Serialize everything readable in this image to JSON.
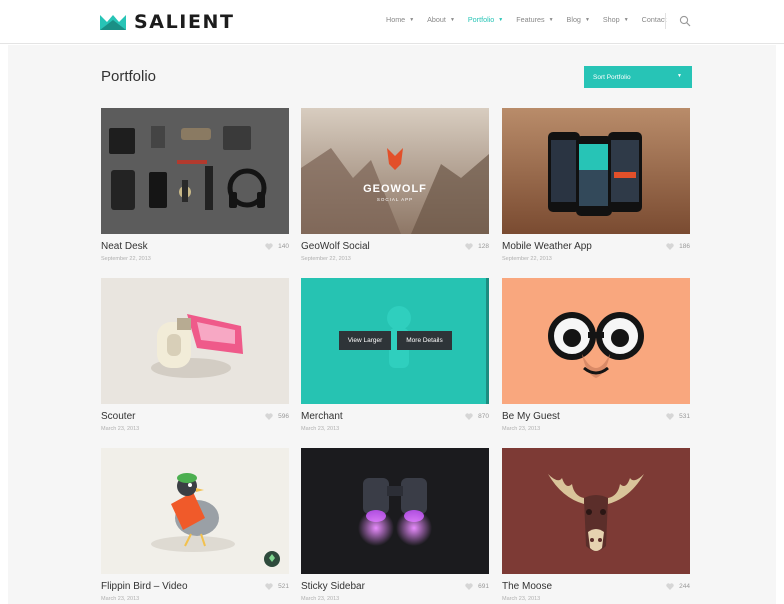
{
  "brand": {
    "name": "SALIENT",
    "accent": "#27c4b6"
  },
  "nav": {
    "items": [
      {
        "label": "Home",
        "has_dropdown": true,
        "active": false
      },
      {
        "label": "About",
        "has_dropdown": true,
        "active": false
      },
      {
        "label": "Portfolio",
        "has_dropdown": true,
        "active": true
      },
      {
        "label": "Features",
        "has_dropdown": true,
        "active": false
      },
      {
        "label": "Blog",
        "has_dropdown": true,
        "active": false
      },
      {
        "label": "Shop",
        "has_dropdown": true,
        "active": false
      },
      {
        "label": "Contact",
        "has_dropdown": false,
        "active": false
      }
    ],
    "search_icon": "search-icon"
  },
  "page": {
    "title": "Portfolio",
    "sort_label": "Sort Portfolio"
  },
  "items": [
    {
      "title": "Neat Desk",
      "date": "September 22, 2013",
      "likes": "140"
    },
    {
      "title": "GeoWolf Social",
      "date": "September 22, 2013",
      "likes": "128",
      "image_text": "GEOWOLF",
      "image_subtext": "SOCIAL APP"
    },
    {
      "title": "Mobile Weather App",
      "date": "September 22, 2013",
      "likes": "186"
    },
    {
      "title": "Scouter",
      "date": "March 23, 2013",
      "likes": "596"
    },
    {
      "title": "Merchant",
      "date": "March 23, 2013",
      "likes": "870",
      "hover_buttons": [
        "View Larger",
        "More Details"
      ]
    },
    {
      "title": "Be My Guest",
      "date": "March 23, 2013",
      "likes": "531"
    },
    {
      "title": "Flippin Bird – Video",
      "date": "March 23, 2013",
      "likes": "521"
    },
    {
      "title": "Sticky Sidebar",
      "date": "March 23, 2013",
      "likes": "691"
    },
    {
      "title": "The Moose",
      "date": "March 23, 2013",
      "likes": "244"
    }
  ]
}
